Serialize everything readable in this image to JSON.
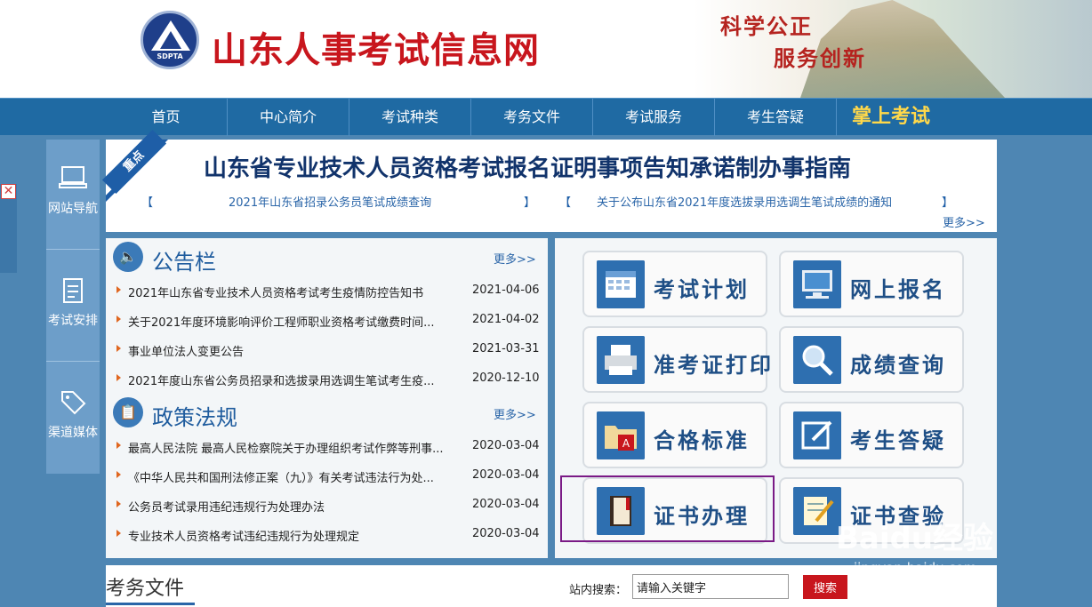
{
  "header": {
    "logo_text": "SDPTA",
    "site_title": "山东人事考试信息网",
    "slogan_line1": "科学公正",
    "slogan_line2": "服务创新"
  },
  "nav": {
    "items": [
      "首页",
      "中心简介",
      "考试种类",
      "考务文件",
      "考试服务",
      "考生答疑"
    ],
    "mobile": "掌上考试"
  },
  "side_nav": [
    {
      "label": "网站导航",
      "icon": "monitor-icon"
    },
    {
      "label": "考试安排",
      "icon": "clipboard-icon"
    },
    {
      "label": "渠道媒体",
      "icon": "tag-icon"
    }
  ],
  "headline": {
    "ribbon": "重点",
    "title": "山东省专业技术人员资格考试报名证明事项告知承诺制办事指南",
    "links": [
      "2021年山东省招录公务员笔试成绩查询",
      "关于公布山东省2021年度选拔录用选调生笔试成绩的通知"
    ],
    "more": "更多>>"
  },
  "notice": {
    "title": "公告栏",
    "more": "更多>>",
    "items": [
      {
        "title": "2021年山东省专业技术人员资格考试考生疫情防控告知书",
        "date": "2021-04-06"
      },
      {
        "title": "关于2021年度环境影响评价工程师职业资格考试缴费时间...",
        "date": "2021-04-02"
      },
      {
        "title": "事业单位法人变更公告",
        "date": "2021-03-31"
      },
      {
        "title": "2021年度山东省公务员招录和选拔录用选调生笔试考生疫...",
        "date": "2020-12-10"
      }
    ]
  },
  "policy": {
    "title": "政策法规",
    "more": "更多>>",
    "items": [
      {
        "title": "最高人民法院 最高人民检察院关于办理组织考试作弊等刑事...",
        "date": "2020-03-04"
      },
      {
        "title": "《中华人民共和国刑法修正案（九）》有关考试违法行为处...",
        "date": "2020-03-04"
      },
      {
        "title": "公务员考试录用违纪违规行为处理办法",
        "date": "2020-03-04"
      },
      {
        "title": "专业技术人员资格考试违纪违规行为处理规定",
        "date": "2020-03-04"
      }
    ]
  },
  "services": [
    {
      "label": "考试计划",
      "icon": "calendar-icon"
    },
    {
      "label": "网上报名",
      "icon": "computer-icon"
    },
    {
      "label": "准考证打印",
      "icon": "printer-icon"
    },
    {
      "label": "成绩查询",
      "icon": "magnifier-icon"
    },
    {
      "label": "合格标准",
      "icon": "folder-pdf-icon"
    },
    {
      "label": "考生答疑",
      "icon": "edit-icon"
    },
    {
      "label": "证书办理",
      "icon": "book-icon"
    },
    {
      "label": "证书查验",
      "icon": "notepad-icon"
    }
  ],
  "bottom": {
    "title": "考务文件",
    "search_label": "站内搜索：",
    "search_value": "请输入关键字",
    "search_button": "搜索"
  },
  "watermark": {
    "brand": "Baidu经验",
    "url": "jingyan.baidu.com"
  }
}
